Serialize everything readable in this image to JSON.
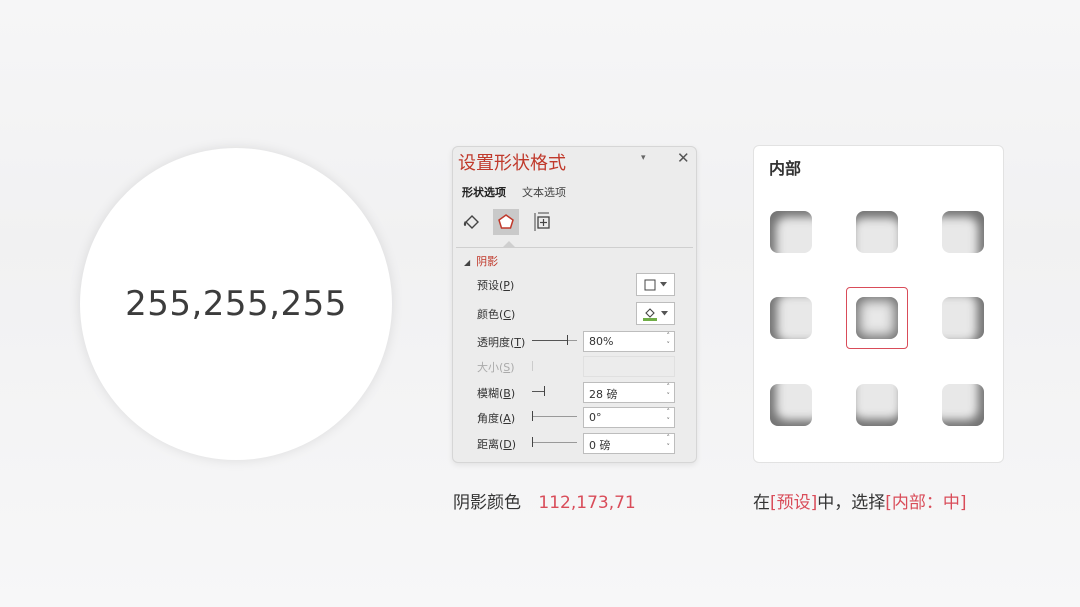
{
  "circle": {
    "rgb_text": "255,255,255"
  },
  "pane": {
    "title": "设置形状格式",
    "dropdown_icon": "▾",
    "close_icon": "✕",
    "tabs": [
      {
        "label": "形状选项",
        "active": true
      },
      {
        "label": "文本选项",
        "active": false
      }
    ],
    "icons": [
      "fill-line-icon",
      "effects-icon",
      "size-properties-icon"
    ],
    "section": {
      "label": "阴影",
      "expand_icon": "◢"
    },
    "rows": {
      "preset": {
        "label": "预设(",
        "key": "P",
        "end": ")"
      },
      "color": {
        "label": "颜色(",
        "key": "C",
        "end": ")"
      },
      "transparency": {
        "label": "透明度(",
        "key": "T",
        "end": ")",
        "value": "80%"
      },
      "size": {
        "label": "大小(",
        "key": "S",
        "end": ")",
        "value": ""
      },
      "blur": {
        "label": "模糊(",
        "key": "B",
        "end": ")",
        "value": "28 磅"
      },
      "angle": {
        "label": "角度(",
        "key": "A",
        "end": ")",
        "value": "0°"
      },
      "distance": {
        "label": "距离(",
        "key": "D",
        "end": ")",
        "value": "0 磅"
      }
    }
  },
  "presets_card": {
    "title": "内部",
    "selected": "center"
  },
  "captions": {
    "left_label": "阴影颜色",
    "left_value": "112,173,71",
    "right_pre": "在",
    "right_accent1": "[预设]",
    "right_mid": "中，选择",
    "right_accent2": "[内部：中]"
  },
  "colors": {
    "accent": "#d94c59",
    "pane_title": "#c0392b",
    "shadow_green": "#70ad47"
  }
}
